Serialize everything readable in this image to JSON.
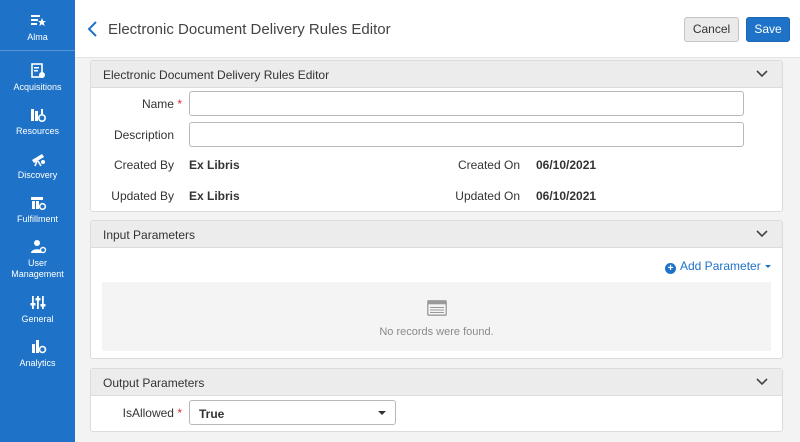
{
  "sidebar": {
    "items": [
      {
        "label": "Alma",
        "icon": "alma-star-icon"
      },
      {
        "label": "Acquisitions",
        "icon": "acquisitions-icon"
      },
      {
        "label": "Resources",
        "icon": "resources-icon"
      },
      {
        "label": "Discovery",
        "icon": "discovery-telescope-icon"
      },
      {
        "label": "Fulfillment",
        "icon": "fulfillment-icon"
      },
      {
        "label": "User Management",
        "icon": "user-management-icon"
      },
      {
        "label": "General",
        "icon": "general-sliders-icon"
      },
      {
        "label": "Analytics",
        "icon": "analytics-icon"
      }
    ]
  },
  "header": {
    "title": "Electronic Document Delivery Rules Editor",
    "cancel_label": "Cancel",
    "save_label": "Save"
  },
  "details_panel": {
    "title": "Electronic Document Delivery Rules Editor",
    "name_label": "Name",
    "name_value": "",
    "description_label": "Description",
    "description_value": "",
    "created_by_label": "Created By",
    "created_by_value": "Ex Libris",
    "created_on_label": "Created On",
    "created_on_value": "06/10/2021",
    "updated_by_label": "Updated By",
    "updated_by_value": "Ex Libris",
    "updated_on_label": "Updated On",
    "updated_on_value": "06/10/2021"
  },
  "input_panel": {
    "title": "Input Parameters",
    "add_label": "Add Parameter",
    "empty_text": "No records were found."
  },
  "output_panel": {
    "title": "Output Parameters",
    "is_allowed_label": "IsAllowed",
    "is_allowed_value": "True"
  },
  "colors": {
    "brand_blue": "#1e73c8",
    "required": "#d0312d"
  }
}
